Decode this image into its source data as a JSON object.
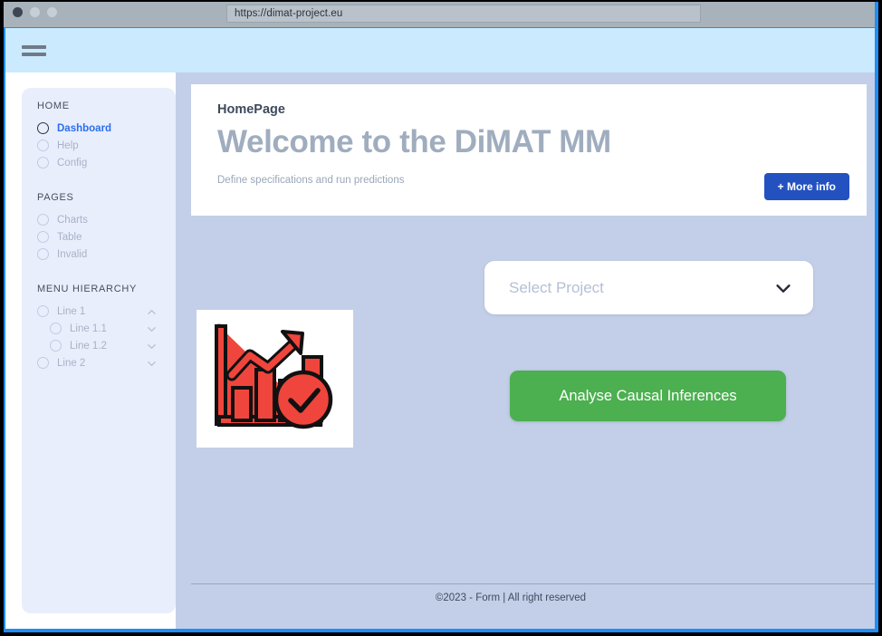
{
  "browser": {
    "url": "https://dimat-project.eu",
    "traffic_lights": [
      "close-dot",
      "minimize-dot",
      "maximize-dot"
    ]
  },
  "topbar": {
    "menu_icon": "hamburger-menu-icon",
    "background_color": "#cbeafd"
  },
  "sidebar": {
    "background_color": "#e9eefc",
    "groups": [
      {
        "title": "HOME",
        "items": [
          {
            "label": "Dashboard",
            "active": true,
            "chevron": null
          },
          {
            "label": "Help",
            "active": false,
            "chevron": null
          },
          {
            "label": "Config",
            "active": false,
            "chevron": null
          }
        ]
      },
      {
        "title": "PAGES",
        "items": [
          {
            "label": "Charts",
            "active": false,
            "chevron": null
          },
          {
            "label": "Table",
            "active": false,
            "chevron": null
          },
          {
            "label": "Invalid",
            "active": false,
            "chevron": null
          }
        ]
      },
      {
        "title": "MENU HIERARCHY",
        "items": [
          {
            "label": "Line 1",
            "active": false,
            "chevron": "up",
            "indent": false
          },
          {
            "label": "Line 1.1",
            "active": false,
            "chevron": "down",
            "indent": true
          },
          {
            "label": "Line 1.2",
            "active": false,
            "chevron": "down",
            "indent": true
          },
          {
            "label": "Line 2",
            "active": false,
            "chevron": "down",
            "indent": false
          }
        ]
      }
    ]
  },
  "header_card": {
    "breadcrumb": "HomePage",
    "heading": "Welcome to the DiMAT MM",
    "subtitle": "Define specifications and run predictions",
    "more_info_label": "+ More info",
    "more_info_color": "#2351c0"
  },
  "main": {
    "illustration": "bar-chart-growth-checkmark-icon",
    "select_project": {
      "placeholder": "Select Project",
      "value": "",
      "chevron": "chevron-down-icon"
    },
    "analyse_button": {
      "label": "Analyse Causal Inferences",
      "color": "#4caf50"
    },
    "background_color": "#c3cfe8"
  },
  "footer": {
    "text": "©2023 - Form  |   All right reserved"
  }
}
